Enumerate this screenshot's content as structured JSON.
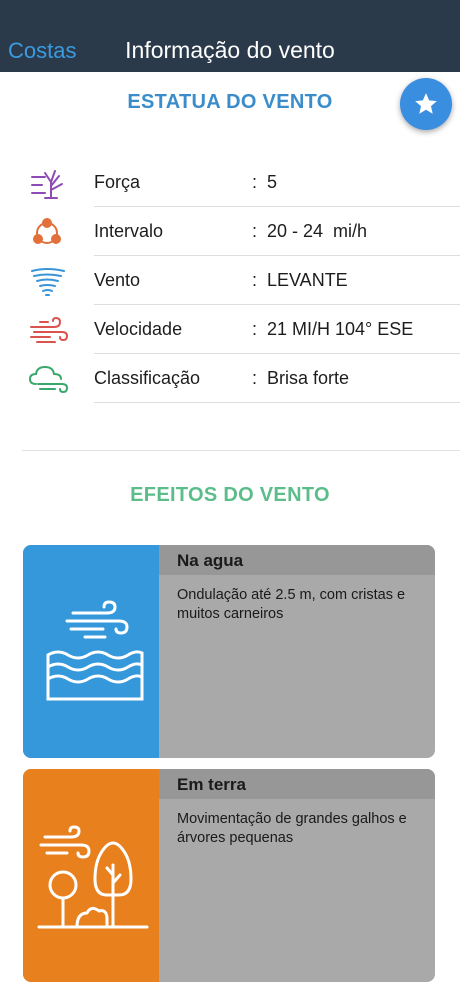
{
  "nav": {
    "back_label": "Costas",
    "title": "Informação do vento"
  },
  "status": {
    "title": "ESTATUA DO VENTO",
    "rows": [
      {
        "label": "Força",
        "value": "5",
        "icon": "force-icon"
      },
      {
        "label": "Intervalo",
        "value": "20 - 24  mi/h",
        "icon": "interval-icon"
      },
      {
        "label": "Vento",
        "value": "LEVANTE",
        "icon": "tornado-icon"
      },
      {
        "label": "Velocidade",
        "value": "21 MI/H 104° ESE",
        "icon": "wind-speed-icon"
      },
      {
        "label": "Classificação",
        "value": "Brisa forte",
        "icon": "cloud-wind-icon"
      }
    ],
    "separator": ":"
  },
  "effects": {
    "title": "EFEITOS DO VENTO",
    "cards": [
      {
        "title": "Na agua",
        "text": "Ondulação até 2.5 m, com cristas e muitos carneiros",
        "icon": "wind-waves-icon"
      },
      {
        "title": "Em terra",
        "text": "Movimentação de grandes galhos e árvores pequenas",
        "icon": "wind-trees-icon"
      }
    ]
  },
  "colors": {
    "navbar": "#2b3a4a",
    "back_link": "#3a9be0",
    "status_title": "#3a8ccb",
    "effects_title": "#5bbd8a",
    "fab": "#3a8ee0",
    "water_card": "#3498db",
    "land_card": "#e8801e",
    "card_body": "#a9a9a9"
  },
  "fab": {
    "icon": "star-icon"
  }
}
